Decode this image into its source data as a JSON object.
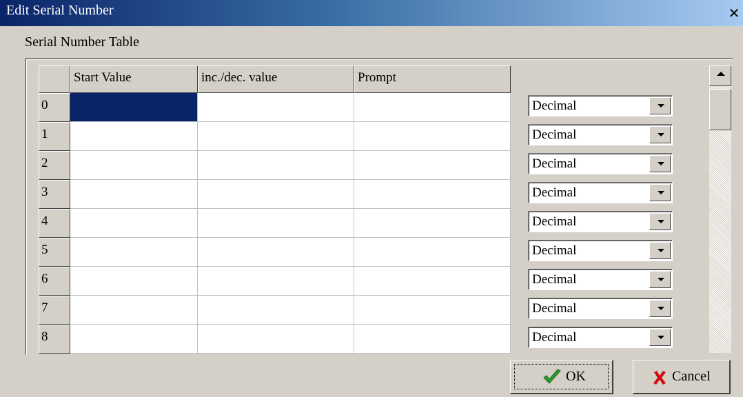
{
  "window": {
    "title": "Edit Serial Number",
    "close_glyph": "✕"
  },
  "group": {
    "label": "Serial Number Table"
  },
  "table": {
    "columns": [
      "Start Value",
      "inc./dec. value",
      "Prompt"
    ],
    "rows": [
      {
        "index": "0",
        "start_value": "",
        "inc_dec_value": "",
        "prompt": "",
        "format": "Decimal"
      },
      {
        "index": "1",
        "start_value": "",
        "inc_dec_value": "",
        "prompt": "",
        "format": "Decimal"
      },
      {
        "index": "2",
        "start_value": "",
        "inc_dec_value": "",
        "prompt": "",
        "format": "Decimal"
      },
      {
        "index": "3",
        "start_value": "",
        "inc_dec_value": "",
        "prompt": "",
        "format": "Decimal"
      },
      {
        "index": "4",
        "start_value": "",
        "inc_dec_value": "",
        "prompt": "",
        "format": "Decimal"
      },
      {
        "index": "5",
        "start_value": "",
        "inc_dec_value": "",
        "prompt": "",
        "format": "Decimal"
      },
      {
        "index": "6",
        "start_value": "",
        "inc_dec_value": "",
        "prompt": "",
        "format": "Decimal"
      },
      {
        "index": "7",
        "start_value": "",
        "inc_dec_value": "",
        "prompt": "",
        "format": "Decimal"
      },
      {
        "index": "8",
        "start_value": "",
        "inc_dec_value": "",
        "prompt": "",
        "format": "Decimal"
      }
    ],
    "selected_cell": "row 0, Start Value"
  },
  "buttons": {
    "ok_label": "OK",
    "ok_icon": "checkmark-icon",
    "cancel_label": "Cancel",
    "cancel_icon": "red-x-icon"
  },
  "colors": {
    "title_bar_start": "#0a246a",
    "title_bar_end": "#a6caf0",
    "selection": "#0a246a",
    "ok_check": "#2e9d2e",
    "cancel_x": "#d01010"
  }
}
